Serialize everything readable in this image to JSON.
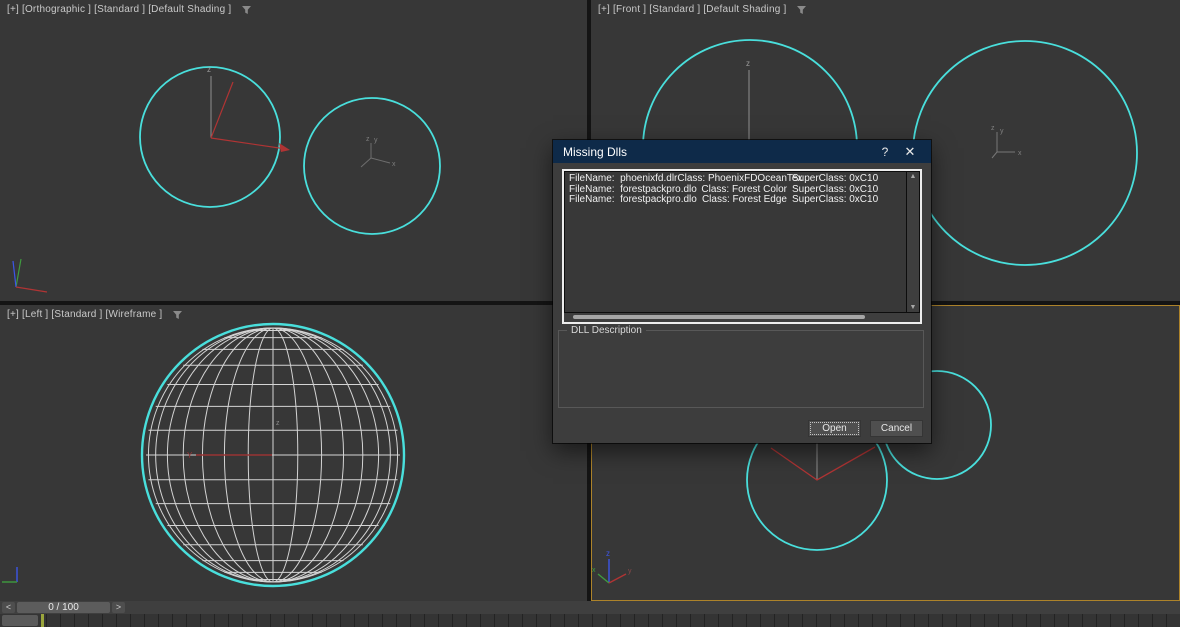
{
  "viewports": {
    "top_left": {
      "label": "[+] [Orthographic ] [Standard ] [Default Shading ]"
    },
    "top_right": {
      "label": "[+] [Front ] [Standard ] [Default Shading ]"
    },
    "bottom_left": {
      "label": "[+] [Left ] [Standard ] [Wireframe ]"
    }
  },
  "dialog": {
    "title": "Missing Dlls",
    "help": "?",
    "close": "✕",
    "list": [
      {
        "filename": "FileName:  phoenixfd.dlr",
        "cls": "Class: PhoenixFDOceanTex",
        "sup": "SuperClass: 0xC10"
      },
      {
        "filename": "FileName:  forestpackpro.dlo",
        "cls": "Class: Forest Color",
        "sup": "SuperClass: 0xC10"
      },
      {
        "filename": "FileName:  forestpackpro.dlo",
        "cls": "Class: Forest Edge",
        "sup": "SuperClass: 0xC10"
      }
    ],
    "group_label": "DLL Description",
    "open_label": "Open",
    "cancel_label": "Cancel"
  },
  "timeline": {
    "prev": "<",
    "value": "0 / 100",
    "next": ">"
  },
  "icons": {
    "viewport_filter": "funnel",
    "scroll_up": "▲",
    "scroll_down": "▼"
  },
  "colors": {
    "selection_cyan": "#49dfdc",
    "active_viewport_border": "#ad832a",
    "wireframe": "#d4d4d4",
    "axis_red": "#b03434",
    "axis_gray": "#8f8f8f",
    "axis_green": "#3f9b3f",
    "axis_blue": "#3c55e6",
    "titlebar_blue": "#0e2a49"
  }
}
